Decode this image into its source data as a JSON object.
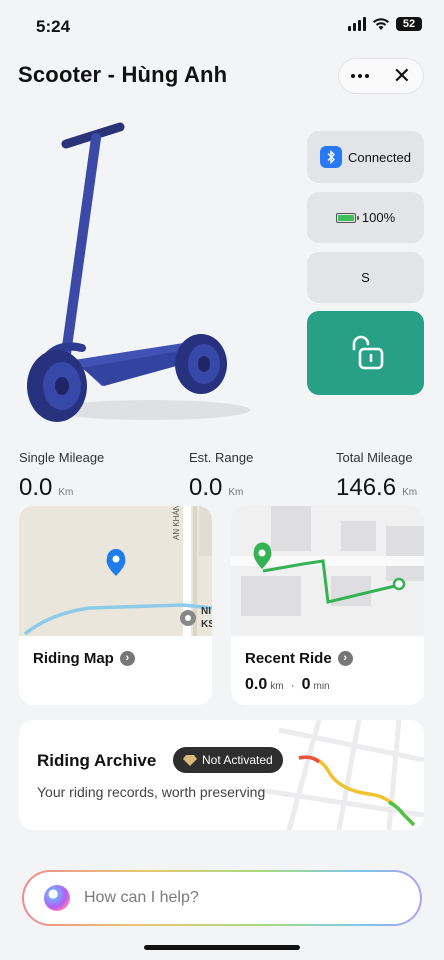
{
  "status_bar": {
    "time": "5:24",
    "battery": "52"
  },
  "header": {
    "title": "Scooter - Hùng Anh"
  },
  "side_panels": {
    "connection": "Connected",
    "battery": "100%",
    "mode": "S"
  },
  "stats": [
    {
      "label": "Single Mileage",
      "value": "0.0",
      "unit": "Km"
    },
    {
      "label": "Est. Range",
      "value": "0.0",
      "unit": "Km"
    },
    {
      "label": "Total Mileage",
      "value": "146.6",
      "unit": "Km"
    }
  ],
  "riding_map": {
    "title": "Riding Map",
    "street_label": "AN KHÁNH",
    "poi_label": "NI\nKS"
  },
  "recent_ride": {
    "title": "Recent Ride",
    "distance": "0.0",
    "distance_unit": "km",
    "separator": "·",
    "duration": "0",
    "duration_unit": "min"
  },
  "riding_archive": {
    "title": "Riding Archive",
    "badge": "Not Activated",
    "subtitle": "Your riding records, worth preserving"
  },
  "assistant": {
    "placeholder": "How can I help?"
  },
  "colors": {
    "accent_green": "#27a086",
    "bluetooth_blue": "#2879f3",
    "battery_green": "#3fbf5c",
    "route_green": "#34b254",
    "map_route_blue": "#8ecbe9"
  }
}
